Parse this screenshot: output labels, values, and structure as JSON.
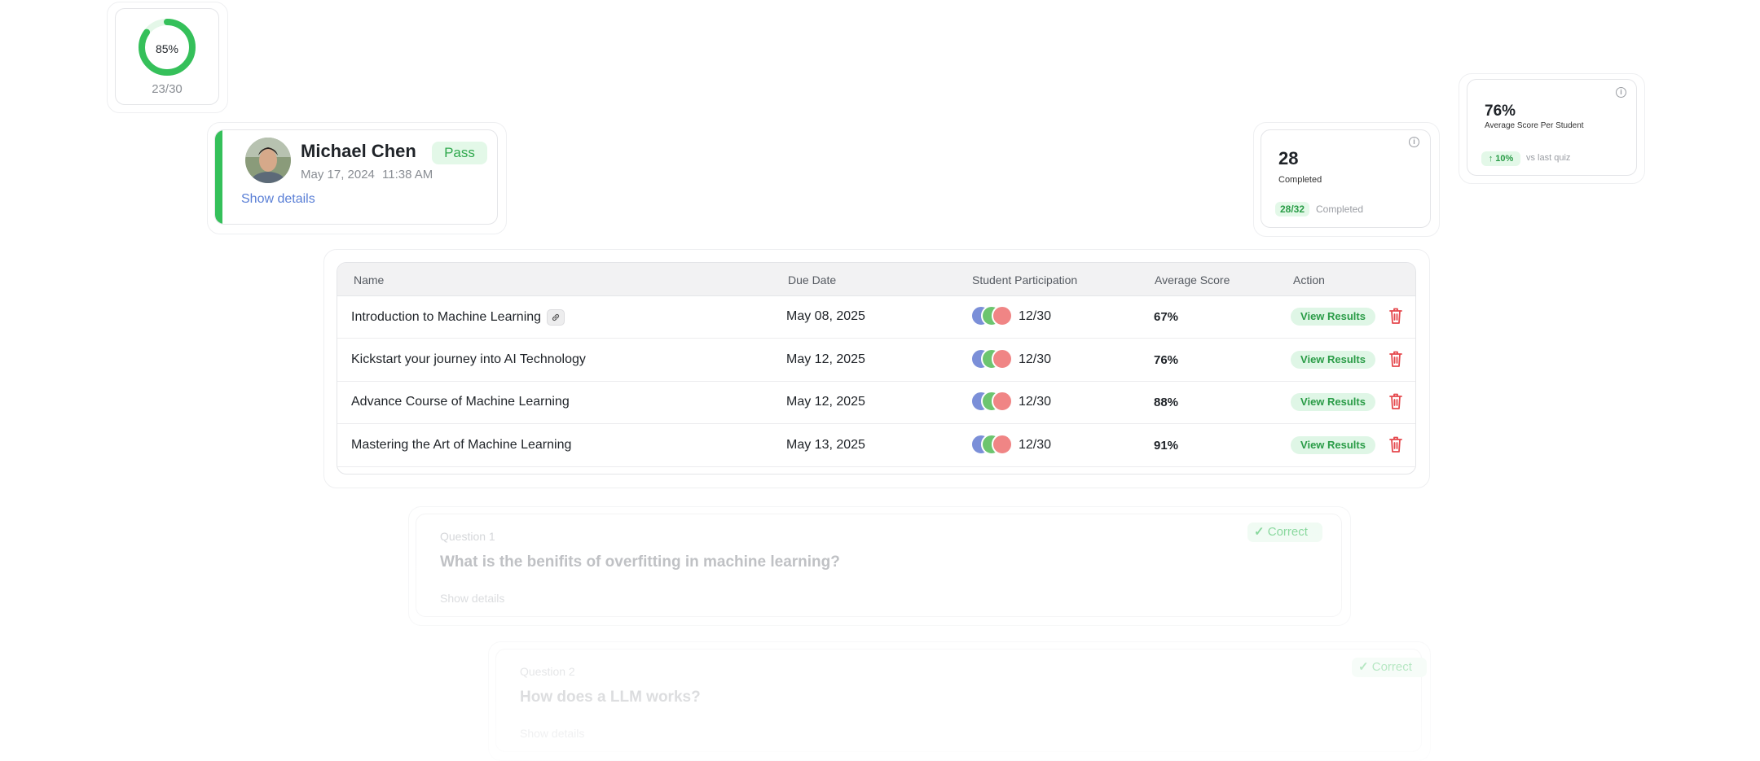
{
  "score_ring": {
    "percent_label": "85%",
    "percent_value": 0.85,
    "fraction": "23/30",
    "color": "#35c05a"
  },
  "profile": {
    "name": "Michael Chen",
    "status": "Pass",
    "date": "May 17, 2024",
    "time": "11:38 AM",
    "details_link": "Show details",
    "accent_color": "#35c05a"
  },
  "stat_completed": {
    "value": "28",
    "label": "Completed",
    "badge": "28/32",
    "badge_caption": "Completed"
  },
  "stat_average": {
    "value": "76%",
    "label": "Average Score Per Student",
    "badge": "10%",
    "badge_caption": "vs last quiz"
  },
  "table": {
    "headers": {
      "name": "Name",
      "due": "Due Date",
      "participation": "Student Participation",
      "score": "Average Score",
      "action": "Action"
    },
    "rows": [
      {
        "name": "Introduction to Machine Learning",
        "has_link": true,
        "due": "May 08, 2025",
        "participation": "12/30",
        "score": "67%",
        "action": "View Results"
      },
      {
        "name": "Kickstart your journey into AI Technology",
        "has_link": false,
        "due": "May 12, 2025",
        "participation": "12/30",
        "score": "76%",
        "action": "View Results"
      },
      {
        "name": "Advance Course of Machine Learning",
        "has_link": false,
        "due": "May 12, 2025",
        "participation": "12/30",
        "score": "88%",
        "action": "View Results"
      },
      {
        "name": "Mastering the Art of Machine Learning",
        "has_link": false,
        "due": "May 13, 2025",
        "participation": "12/30",
        "score": "91%",
        "action": "View Results"
      }
    ]
  },
  "questions": [
    {
      "label": "Question 1",
      "text": "What is the benifits of overfitting in machine learning?",
      "status": "Correct",
      "details": "Show details"
    },
    {
      "label": "Question 2",
      "text": "How does a LLM works?",
      "status": "Correct",
      "details": "Show details"
    }
  ],
  "colors": {
    "danger": "#e5484d",
    "success": "#35c05a",
    "link": "#5a7fd6"
  }
}
